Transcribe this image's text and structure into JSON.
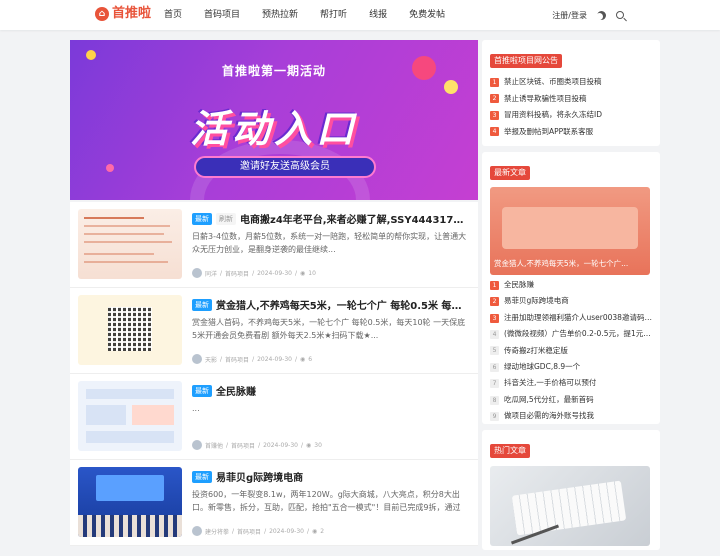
{
  "header": {
    "logo_text": "首推啦",
    "nav": [
      "首页",
      "首码项目",
      "预热拉新",
      "帮打听",
      "线报",
      "免费发帖"
    ],
    "login_label": "注册/登录"
  },
  "banner": {
    "title": "首推啦第一期活动",
    "big_text": "活动入口",
    "pill_text": "邀请好友送高级会员"
  },
  "posts": [
    {
      "tags": [
        "最新",
        "刷新"
      ],
      "title": "电商搬z4年老平台,来者必赚了解,SSY444317324",
      "excerpt": "日薪3-4位数，月薪5位数，系统一对一陪跑，轻松简单的帮你实现，让普通大众无压力创业，是翻身逆袭的最佳继续...",
      "author": "同洋",
      "category": "首码项目",
      "date": "2024-09-30",
      "views": "10"
    },
    {
      "tags": [
        "最新"
      ],
      "title": "赏金猎人,不养鸡每天5米，一轮七个广 每轮0.5米 每天...",
      "excerpt": "赏金猎人首码，不养鸡每天5米，一轮七个广 每轮0.5米，每天10轮 一天保底5米开通会员免费看剧 额外每天2.5米★扫码下载★...",
      "author": "天影",
      "category": "首码项目",
      "date": "2024-09-30",
      "views": "6"
    },
    {
      "tags": [
        "最新"
      ],
      "title": "全民脉赚",
      "excerpt": "...",
      "author": "首赚他",
      "category": "首码项目",
      "date": "2024-09-30",
      "views": "30"
    },
    {
      "tags": [
        "最新"
      ],
      "title": "易菲贝g际跨境电商",
      "excerpt": "投资600，一年裂变8.1w，两年120W。g际大商城，八大亮点，积分8大出口。新零售，拆分，互助，匹配，抢拍\"五合一模式\"！目前已完成9拆，通过危险期，进入快速发展期！...",
      "author": "建分将拳",
      "category": "首码项目",
      "date": "2024-09-30",
      "views": "2"
    }
  ],
  "sidebar": {
    "notice_title": "首推啦项目网公告",
    "notices": [
      "禁止区块链、币圈类项目投稿",
      "禁止诱导欺骗性项目投稿",
      "冒用资料投稿，将永久冻结ID",
      "举报及删帖到APP联系客服"
    ],
    "new_title": "最新文章",
    "new_image_caption": "赏金猎人,不养鸡每天5米，一轮七个广...",
    "new_items": [
      "全民脉赚",
      "易菲贝g际跨境电商",
      "注册加助理领福利猫介人user0038邀请码PM...",
      "(微微段视频）广告单价0.2-0.5元，提1元起...",
      "传奇搬z打米稳定版",
      "绿动地球GDC,8.9一个",
      "抖音关注,一手价格可以预付",
      "吃瓜网,5代分红，最新首码",
      "做项目必需的海外账号找我"
    ],
    "hot_title": "热门文章"
  }
}
